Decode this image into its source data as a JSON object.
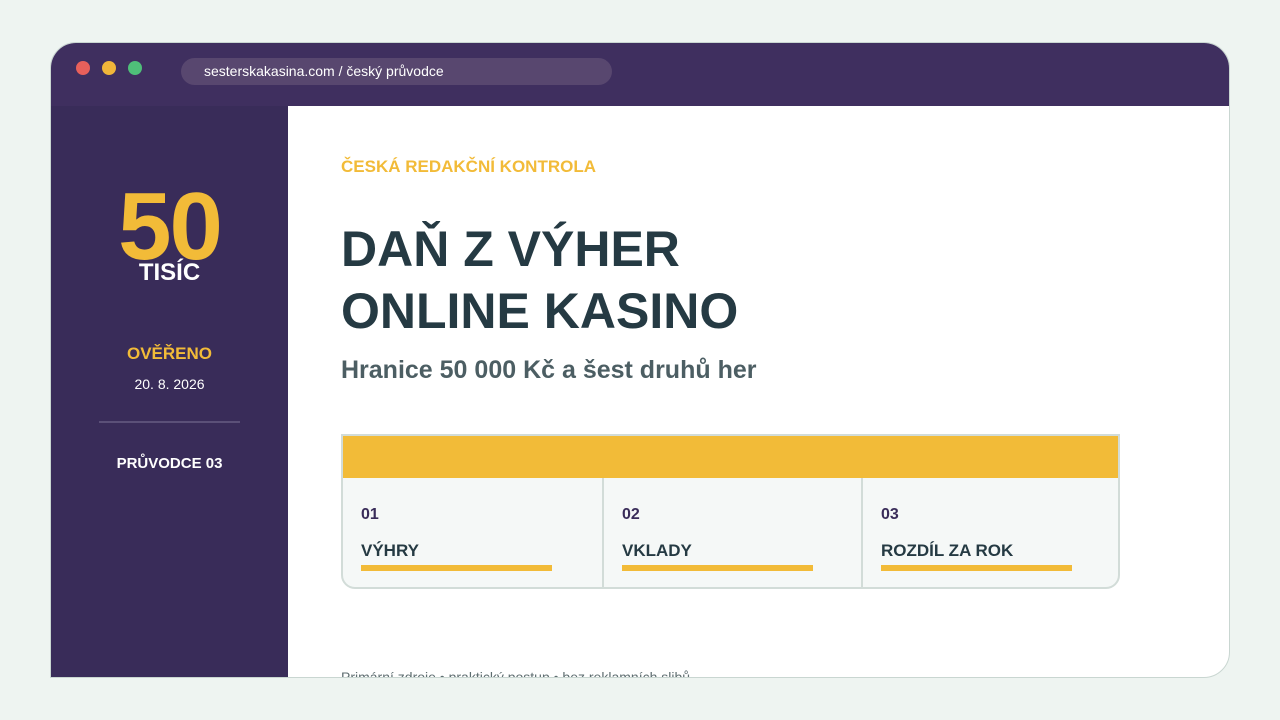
{
  "browser": {
    "url": "sesterskakasina.com / český průvodce",
    "colors": {
      "titlebar": "#3f2f5f",
      "close": "#e8605b",
      "minimize": "#f0b63a",
      "maximize": "#4fbf79"
    }
  },
  "sidebar": {
    "big_number": "50",
    "big_unit": "TISÍC",
    "verified_label": "OVĚŘENO",
    "verified_date": "20. 8. 2026",
    "guide_label": "PRŮVODCE 03"
  },
  "main": {
    "kicker": "ČESKÁ REDAKČNÍ KONTROLA",
    "headline_line1": "DAŇ Z VÝHER",
    "headline_line2": "ONLINE KASINO",
    "subheadline": "Hranice 50 000 Kč a šest druhů her",
    "cards": [
      {
        "number": "01",
        "label": "VÝHRY"
      },
      {
        "number": "02",
        "label": "VKLADY"
      },
      {
        "number": "03",
        "label": "ROZDÍL ZA ROK"
      }
    ],
    "footer_note": "Primární zdroje • praktický postup • bez reklamních slibů"
  },
  "colors": {
    "accent": "#f2bb38",
    "sidebar": "#392c59",
    "heading": "#253a43"
  }
}
